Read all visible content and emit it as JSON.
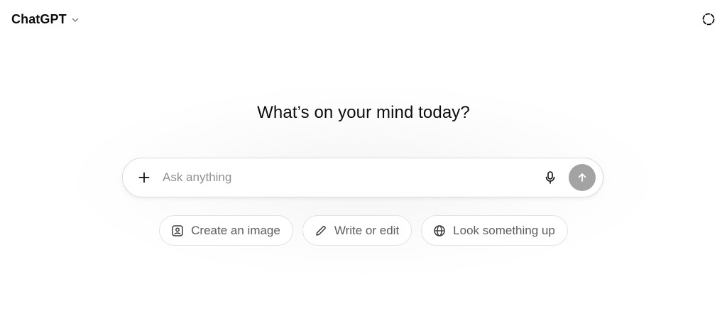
{
  "header": {
    "model_name": "ChatGPT",
    "model_chevron_icon": "chevron-down-icon",
    "temporary_chat_icon": "dashed-circle-icon"
  },
  "main": {
    "heading": "What’s on your mind today?"
  },
  "composer": {
    "placeholder": "Ask anything",
    "value": "",
    "attach_icon": "plus-icon",
    "voice_icon": "microphone-icon",
    "send_icon": "arrow-up-icon",
    "send_button_color": "#a3a3a3"
  },
  "suggestions": [
    {
      "label": "Create an image",
      "icon": "image-icon"
    },
    {
      "label": "Write or edit",
      "icon": "pencil-icon"
    },
    {
      "label": "Look something up",
      "icon": "globe-icon"
    }
  ],
  "colors": {
    "text_primary": "#0d0d0d",
    "text_muted": "#5d5d5d",
    "placeholder": "#8f8f8f",
    "border": "#dcdcdc"
  }
}
